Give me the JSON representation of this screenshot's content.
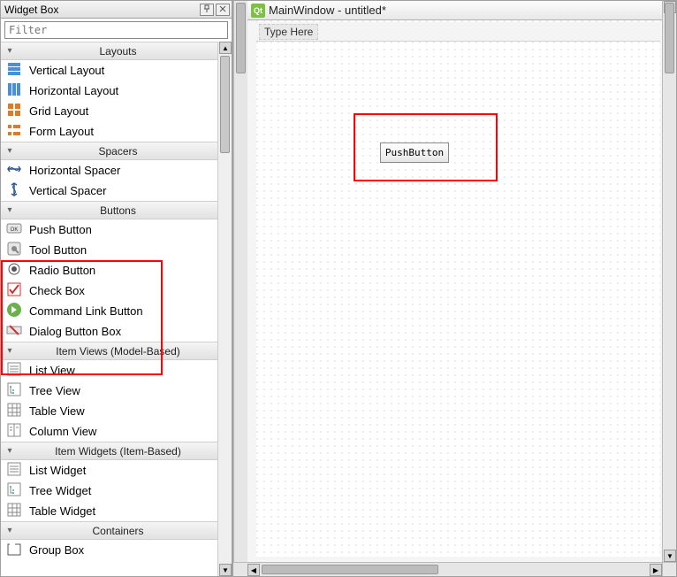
{
  "widgetBox": {
    "title": "Widget Box",
    "pin_tooltip": "Pin",
    "close_tooltip": "Close",
    "filter_placeholder": "Filter",
    "groups": [
      {
        "label": "Layouts",
        "items": [
          {
            "name": "Vertical Layout",
            "icon": "vlayout"
          },
          {
            "name": "Horizontal Layout",
            "icon": "hlayout"
          },
          {
            "name": "Grid Layout",
            "icon": "gridlayout"
          },
          {
            "name": "Form Layout",
            "icon": "formlayout"
          }
        ]
      },
      {
        "label": "Spacers",
        "items": [
          {
            "name": "Horizontal Spacer",
            "icon": "hspacer"
          },
          {
            "name": "Vertical Spacer",
            "icon": "vspacer"
          }
        ]
      },
      {
        "label": "Buttons",
        "items": [
          {
            "name": "Push Button",
            "icon": "pushbutton"
          },
          {
            "name": "Tool Button",
            "icon": "toolbutton"
          },
          {
            "name": "Radio Button",
            "icon": "radiobutton"
          },
          {
            "name": "Check Box",
            "icon": "checkbox"
          },
          {
            "name": "Command Link Button",
            "icon": "commandlink"
          },
          {
            "name": "Dialog Button Box",
            "icon": "dialogbb"
          }
        ]
      },
      {
        "label": "Item Views (Model-Based)",
        "items": [
          {
            "name": "List View",
            "icon": "listview"
          },
          {
            "name": "Tree View",
            "icon": "treeview"
          },
          {
            "name": "Table View",
            "icon": "tableview"
          },
          {
            "name": "Column View",
            "icon": "columnview"
          }
        ]
      },
      {
        "label": "Item Widgets (Item-Based)",
        "items": [
          {
            "name": "List Widget",
            "icon": "listview"
          },
          {
            "name": "Tree Widget",
            "icon": "treeview"
          },
          {
            "name": "Table Widget",
            "icon": "tableview"
          }
        ]
      },
      {
        "label": "Containers",
        "items": [
          {
            "name": "Group Box",
            "icon": "groupbox"
          }
        ]
      }
    ]
  },
  "designer": {
    "window_title": "MainWindow - untitled*",
    "menubar_placeholder": "Type Here",
    "placed_widget_label": "PushButton"
  }
}
